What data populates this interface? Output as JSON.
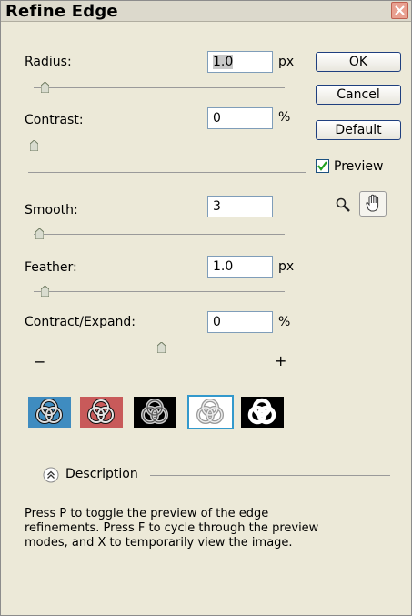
{
  "window": {
    "title": "Refine Edge"
  },
  "controls": {
    "radius": {
      "label": "Radius:",
      "value": "1.0",
      "unit": "px",
      "slider_level": 0.08
    },
    "contrast": {
      "label": "Contrast:",
      "value": "0",
      "unit": "%",
      "slider_level": 0.0
    },
    "smooth": {
      "label": "Smooth:",
      "value": "3",
      "slider_level": 0.04
    },
    "feather": {
      "label": "Feather:",
      "value": "1.0",
      "unit": "px",
      "slider_level": 0.08
    },
    "contract_expand": {
      "label": "Contract/Expand:",
      "value": "0",
      "unit": "%",
      "slider_level": 0.5,
      "minus": "−",
      "plus": "+"
    }
  },
  "buttons": {
    "ok": "OK",
    "cancel": "Cancel",
    "default": "Default"
  },
  "preview": {
    "label": "Preview",
    "checked": true
  },
  "tools": [
    "zoom-icon",
    "hand-icon"
  ],
  "view_modes": [
    {
      "name": "standard",
      "background": "#3f8cc0"
    },
    {
      "name": "quick-mask",
      "background": "#c85a5a"
    },
    {
      "name": "on-black",
      "background": "#000000"
    },
    {
      "name": "on-white",
      "background": "#ffffff",
      "selected": true
    },
    {
      "name": "mask",
      "background": "#000000"
    }
  ],
  "description": {
    "toggle_label": "Description",
    "lines": [
      "Press P to toggle the preview of the edge",
      "refinements. Press F to cycle through the preview",
      "modes, and X to temporarily view the image."
    ]
  },
  "colors": {
    "dialog_bg": "#ece9d8",
    "field_border": "#7f9db9",
    "accent_selected": "#3399cc"
  }
}
